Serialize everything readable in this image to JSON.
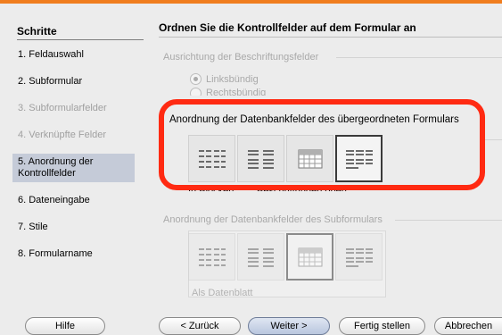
{
  "sidebar": {
    "heading": "Schritte",
    "steps": [
      {
        "label": "1. Feldauswahl",
        "state": "enabled"
      },
      {
        "label": "2. Subformular",
        "state": "enabled"
      },
      {
        "label": "3. Subformularfelder",
        "state": "disabled"
      },
      {
        "label": "4. Verknüpfte Felder",
        "state": "disabled"
      },
      {
        "label": "5. Anordnung der Kontrollfelder",
        "state": "active"
      },
      {
        "label": "6. Dateneingabe",
        "state": "enabled"
      },
      {
        "label": "7. Stile",
        "state": "enabled"
      },
      {
        "label": "8. Formularname",
        "state": "enabled"
      }
    ]
  },
  "main": {
    "title": "Ordnen Sie die Kontrollfelder auf dem Formular an",
    "label_alignment": {
      "label": "Ausrichtung der Beschriftungsfelder",
      "options": [
        "Linksbündig",
        "Rechtsbündig"
      ],
      "selected": "Linksbündig"
    },
    "master_arrangement": {
      "label": "Anordnung der Datenbankfelder des übergeordneten Formulars",
      "partial_captions": [
        "In Blöcken",
        "Beschriftungen oben"
      ],
      "selected_index": 3
    },
    "sub_arrangement": {
      "label": "Anordnung der Datenbankfelder des Subformulars",
      "caption": "Als Datenblatt",
      "selected_index": 2
    }
  },
  "buttons": {
    "help": "Hilfe",
    "back": "< Zurück",
    "next": "Weiter >",
    "finish": "Fertig stellen",
    "cancel": "Abbrechen"
  },
  "colors": {
    "accent_bar": "#f07d1e",
    "highlight": "#ff2a12",
    "active_step": "#c5cbd8"
  }
}
